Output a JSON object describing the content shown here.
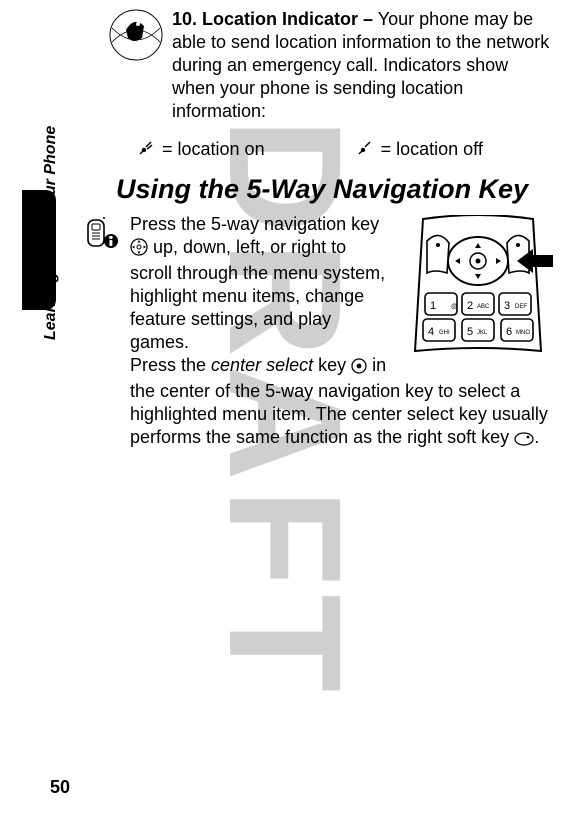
{
  "watermark": "DRAFT",
  "sidebar_label": "Learning to Use Your Phone",
  "page_number": "50",
  "location_indicator": {
    "heading": "10. Location Indicator –",
    "body": " Your phone may be able to send location information to the network during an emergency call. Indicators show when your phone is sending location information:",
    "on_label": "= location on",
    "off_label": "= location off"
  },
  "section_title": "Using the 5-Way Navigation Key",
  "nav_key": {
    "p1a": "Press the 5-way navigation key ",
    "p1b": " up, down, left, or right to scroll through the menu system, highlight menu items, change feature settings, and play games.",
    "p2a": "Press the ",
    "p2_em": "center select",
    "p2b": " key ",
    "p2c": " in the center of the 5-way navigation key to select a highlighted menu item. The center select key usually performs the same function as the right soft key ",
    "p2d": "."
  }
}
